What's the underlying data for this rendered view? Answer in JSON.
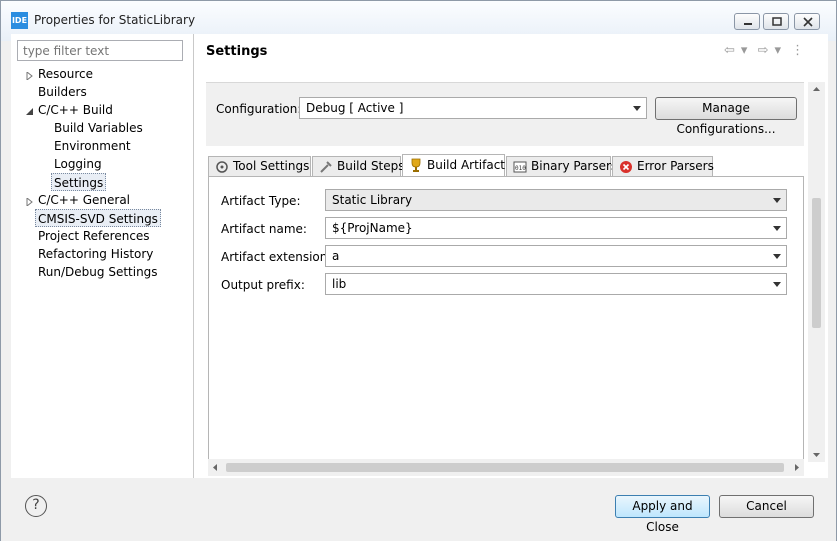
{
  "window": {
    "title": "Properties for StaticLibrary",
    "icon_text": "IDE"
  },
  "tree": {
    "filter_placeholder": "type filter text",
    "items": [
      {
        "label": "Resource"
      },
      {
        "label": "Builders"
      },
      {
        "label": "C/C++ Build"
      },
      {
        "label": "Build Variables"
      },
      {
        "label": "Environment"
      },
      {
        "label": "Logging"
      },
      {
        "label": "Settings"
      },
      {
        "label": "C/C++ General"
      },
      {
        "label": "CMSIS-SVD Settings"
      },
      {
        "label": "Project References"
      },
      {
        "label": "Refactoring History"
      },
      {
        "label": "Run/Debug Settings"
      }
    ]
  },
  "page": {
    "title": "Settings"
  },
  "config": {
    "label": "Configuration:",
    "value": "Debug  [ Active ]",
    "manage_label": "Manage Configurations..."
  },
  "tabs": [
    {
      "label": "Tool Settings"
    },
    {
      "label": "Build Steps"
    },
    {
      "label": "Build Artifact"
    },
    {
      "label": "Binary Parsers"
    },
    {
      "label": "Error Parsers"
    }
  ],
  "artifact": {
    "type_label": "Artifact Type:",
    "type_value": "Static Library",
    "name_label": "Artifact name:",
    "name_value": "${ProjName}",
    "ext_label": "Artifact extension:",
    "ext_value": "a",
    "prefix_label": "Output prefix:",
    "prefix_value": "lib"
  },
  "footer": {
    "help": "?",
    "apply_label": "Apply and Close",
    "cancel_label": "Cancel"
  }
}
